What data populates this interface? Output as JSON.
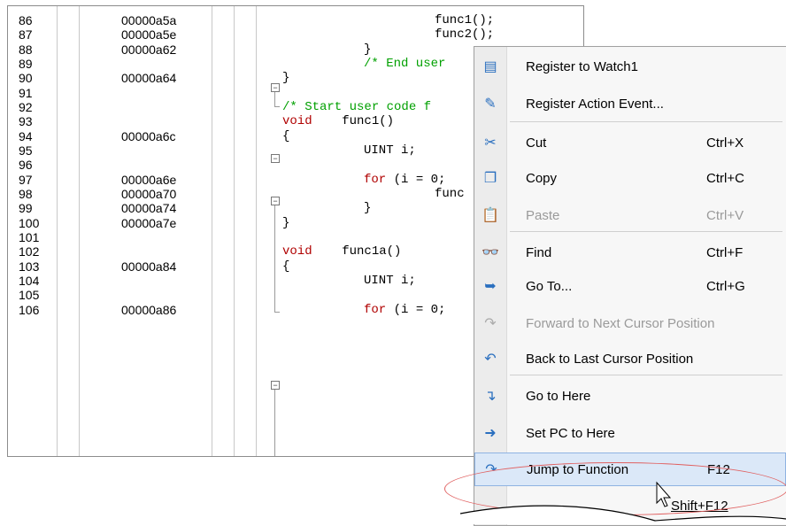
{
  "editor": {
    "rows": [
      {
        "num": "86",
        "addr": "00000a5a",
        "code": "func1();"
      },
      {
        "num": "87",
        "addr": "00000a5e",
        "code": "func2();"
      },
      {
        "num": "88",
        "addr": "00000a62",
        "code": "}"
      },
      {
        "num": "89",
        "addr": "",
        "code": "/* End user"
      },
      {
        "num": "90",
        "addr": "00000a64",
        "code": "}"
      },
      {
        "num": "91",
        "addr": "",
        "code": ""
      },
      {
        "num": "92",
        "addr": "",
        "code": "/* Start user code f"
      },
      {
        "num": "93",
        "addr": "",
        "code": "void    func1()"
      },
      {
        "num": "94",
        "addr": "00000a6c",
        "code": "{"
      },
      {
        "num": "95",
        "addr": "",
        "code": "UINT i;"
      },
      {
        "num": "96",
        "addr": "",
        "code": ""
      },
      {
        "num": "97",
        "addr": "00000a6e",
        "code": "for (i = 0;"
      },
      {
        "num": "98",
        "addr": "00000a70",
        "code": "func"
      },
      {
        "num": "99",
        "addr": "00000a74",
        "code": "}"
      },
      {
        "num": "100",
        "addr": "00000a7e",
        "code": "}"
      },
      {
        "num": "101",
        "addr": "",
        "code": ""
      },
      {
        "num": "102",
        "addr": "",
        "code": "void    func1a()"
      },
      {
        "num": "103",
        "addr": "00000a84",
        "code": "{"
      },
      {
        "num": "104",
        "addr": "",
        "code": "UINT i;"
      },
      {
        "num": "105",
        "addr": "",
        "code": ""
      },
      {
        "num": "106",
        "addr": "00000a86",
        "code": "for (i = 0;"
      }
    ]
  },
  "menu": {
    "items": [
      {
        "label": "Register to Watch1",
        "accel": "",
        "icon": "watch-icon",
        "disabled": false
      },
      {
        "label": "Register Action Event...",
        "accel": "",
        "icon": "action-event-icon",
        "disabled": false
      },
      {
        "label": "Cut",
        "accel": "Ctrl+X",
        "icon": "scissors-icon",
        "disabled": false
      },
      {
        "label": "Copy",
        "accel": "Ctrl+C",
        "icon": "copy-icon",
        "disabled": false
      },
      {
        "label": "Paste",
        "accel": "Ctrl+V",
        "icon": "paste-icon",
        "disabled": true
      },
      {
        "label": "Find",
        "accel": "Ctrl+F",
        "icon": "binoculars-icon",
        "disabled": false
      },
      {
        "label": "Go To...",
        "accel": "Ctrl+G",
        "icon": "go-to-icon",
        "disabled": false
      },
      {
        "label": "Forward to Next Cursor Position",
        "accel": "",
        "icon": "forward-arrow-icon",
        "disabled": true
      },
      {
        "label": "Back to Last Cursor Position",
        "accel": "",
        "icon": "back-arrow-icon",
        "disabled": false
      },
      {
        "label": "Go to Here",
        "accel": "",
        "icon": "go-here-icon",
        "disabled": false
      },
      {
        "label": "Set PC to Here",
        "accel": "",
        "icon": "set-pc-icon",
        "disabled": false
      },
      {
        "label": "Jump to Function",
        "accel": "F12",
        "icon": "jump-icon",
        "disabled": false
      },
      {
        "label": "",
        "accel": "Shift+F12",
        "icon": "",
        "disabled": false
      }
    ]
  },
  "colors": {
    "keyword": "#b00000",
    "comment": "#00a000",
    "highlight_oval": "#e06060"
  }
}
